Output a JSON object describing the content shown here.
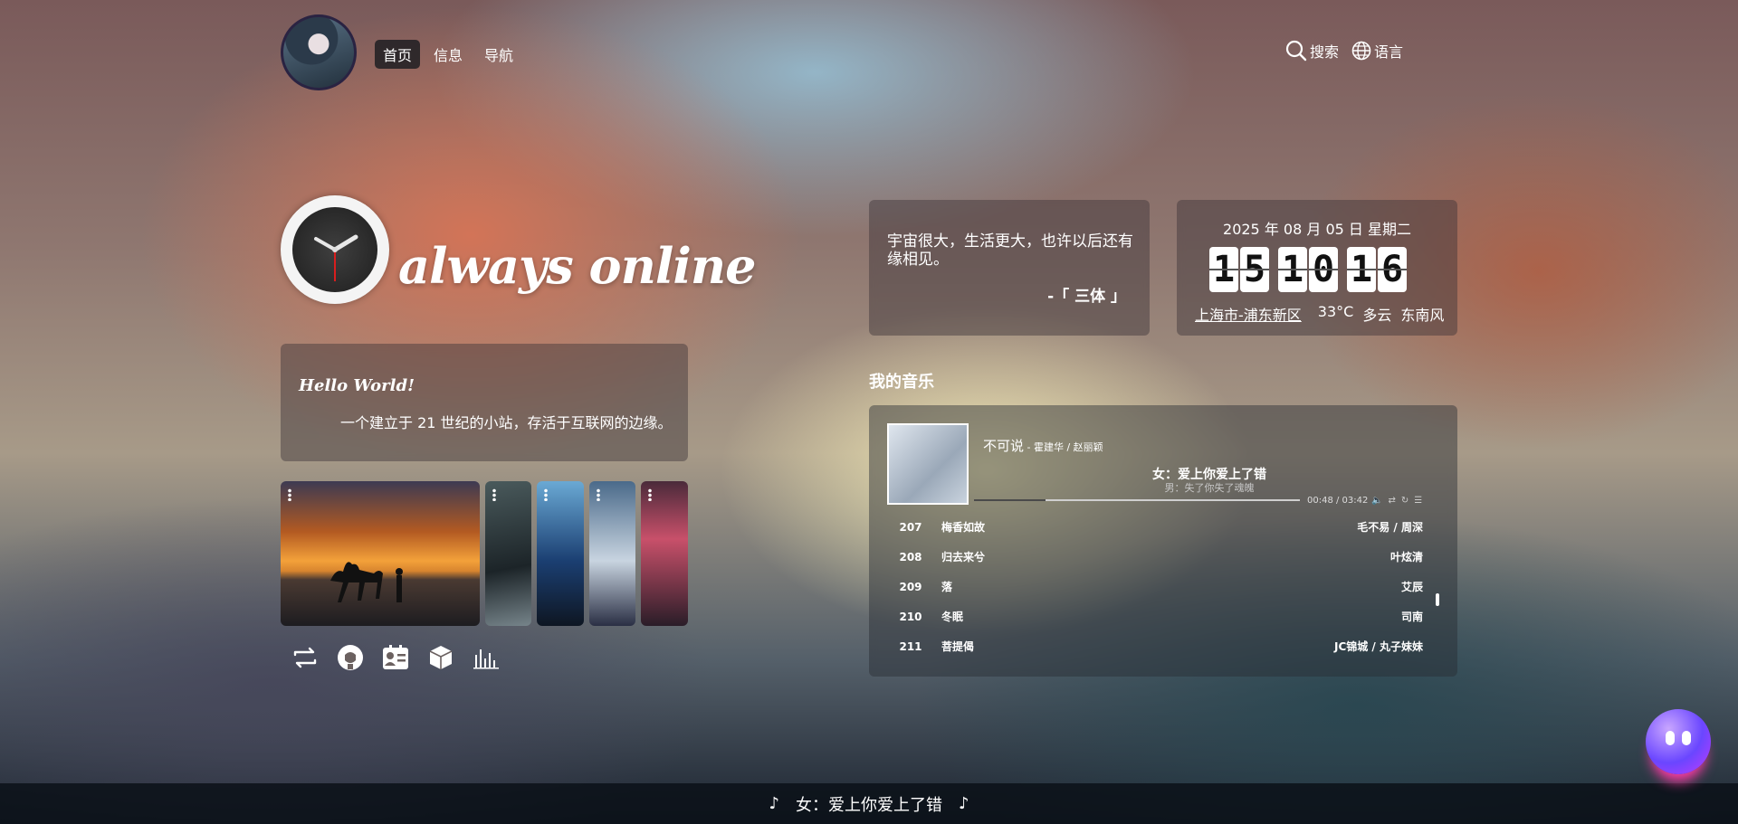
{
  "nav": {
    "links": [
      "首页",
      "信息",
      "导航"
    ],
    "search_label": "搜索",
    "language_label": "语言"
  },
  "logo": {
    "text": "always online"
  },
  "hello": {
    "title": "Hello World!",
    "description": "一个建立于 21 世纪的小站，存活于互联网的边缘。"
  },
  "quote": {
    "text": "宇宙很大，生活更大，也许以后还有缘相见。",
    "source": "-「 三体 」"
  },
  "clock": {
    "date": "2025 年 08 月 05 日 星期二",
    "hours": [
      "1",
      "5"
    ],
    "minutes": [
      "1",
      "0"
    ],
    "seconds": [
      "1",
      "6"
    ],
    "location": "上海市-浦东新区",
    "temperature": "33°C",
    "condition": "多云",
    "wind": "东南风"
  },
  "music": {
    "section_title": "我的音乐",
    "song_title": "不可说",
    "song_artist": " - 霍建华 / 赵丽颖",
    "lyric_main": "女：爱上你爱上了错",
    "lyric_sub": "男：失了你失了魂魄",
    "time": "00:48 / 03:42",
    "progress": 0.22,
    "playlist": [
      {
        "num": "207",
        "name": "梅香如故",
        "artist": "毛不易 / 周深"
      },
      {
        "num": "208",
        "name": "归去来兮",
        "artist": "叶炫清"
      },
      {
        "num": "209",
        "name": "落",
        "artist": "艾辰"
      },
      {
        "num": "210",
        "name": "冬眠",
        "artist": "司南"
      },
      {
        "num": "211",
        "name": "菩提偈",
        "artist": "JC锦城 / 丸子妹妹"
      }
    ]
  },
  "footer": {
    "lyric": "女：爱上你爱上了错"
  }
}
